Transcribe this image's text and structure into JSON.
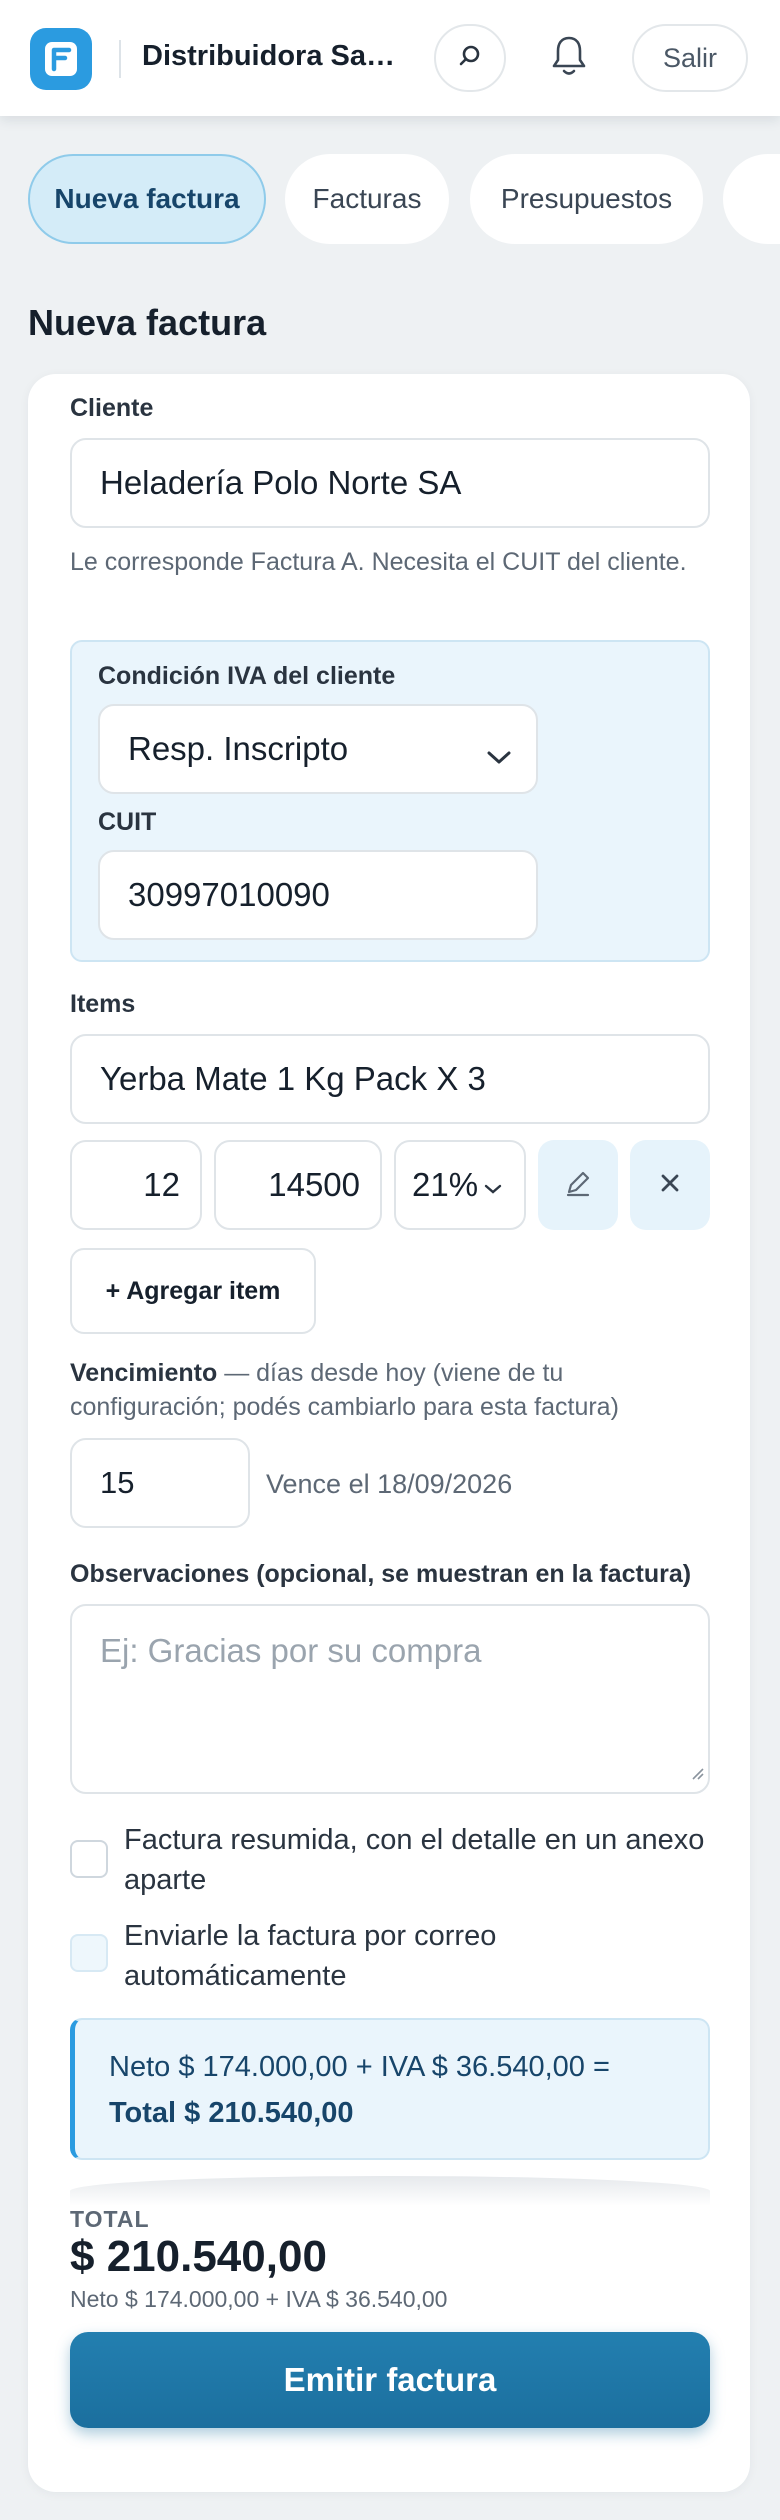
{
  "header": {
    "brand": "Distribuidora San ...",
    "logout_label": "Salir",
    "icons": {
      "logo": "invoice-logo-icon",
      "search": "search-icon",
      "notifications": "bell-icon"
    }
  },
  "tabs": [
    {
      "label": "Nueva factura",
      "active": true
    },
    {
      "label": "Facturas",
      "active": false
    },
    {
      "label": "Presupuestos",
      "active": false
    },
    {
      "label": "",
      "active": false
    }
  ],
  "page_title": "Nueva factura",
  "form": {
    "client": {
      "label": "Cliente",
      "value": "Heladería Polo Norte SA",
      "hint": "Le corresponde Factura A. Necesita el CUIT del cliente."
    },
    "iva": {
      "label": "Condición IVA del cliente",
      "selected": "Resp. Inscripto",
      "cuit_label": "CUIT",
      "cuit_value": "30997010090"
    },
    "items": {
      "label": "Items",
      "rows": [
        {
          "description": "Yerba Mate 1 Kg Pack X 3",
          "quantity": "12",
          "price": "14500",
          "iva_rate": "21%"
        }
      ],
      "add_label": "+ Agregar item"
    },
    "due": {
      "label": "Vencimiento",
      "note": " — días desde hoy (viene de tu configuración; podés cambiarlo para esta factura)",
      "days": "15",
      "due_text": "Vence el 18/09/2026"
    },
    "notes": {
      "label": "Observaciones (opcional, se muestran en la factura)",
      "placeholder": "Ej: Gracias por su compra",
      "value": ""
    },
    "options": [
      {
        "label": "Factura resumida, con el detalle en un anexo aparte",
        "checked": false
      },
      {
        "label": "Enviarle la factura por correo automáticamente",
        "checked": false
      }
    ],
    "summary": {
      "line": "Neto $ 174.000,00 + IVA $ 36.540,00 =",
      "total_line": "Total $ 210.540,00"
    }
  },
  "footer": {
    "total_label": "TOTAL",
    "total_value": "$ 210.540,00",
    "breakdown": "Neto $ 174.000,00 + IVA $ 36.540,00",
    "emit_label": "Emitir factura"
  },
  "colors": {
    "accent": "#2b9be0",
    "primary_button": "#1b6f9e",
    "info_background": "#eaf5fc",
    "page_background": "#eef1f3"
  }
}
